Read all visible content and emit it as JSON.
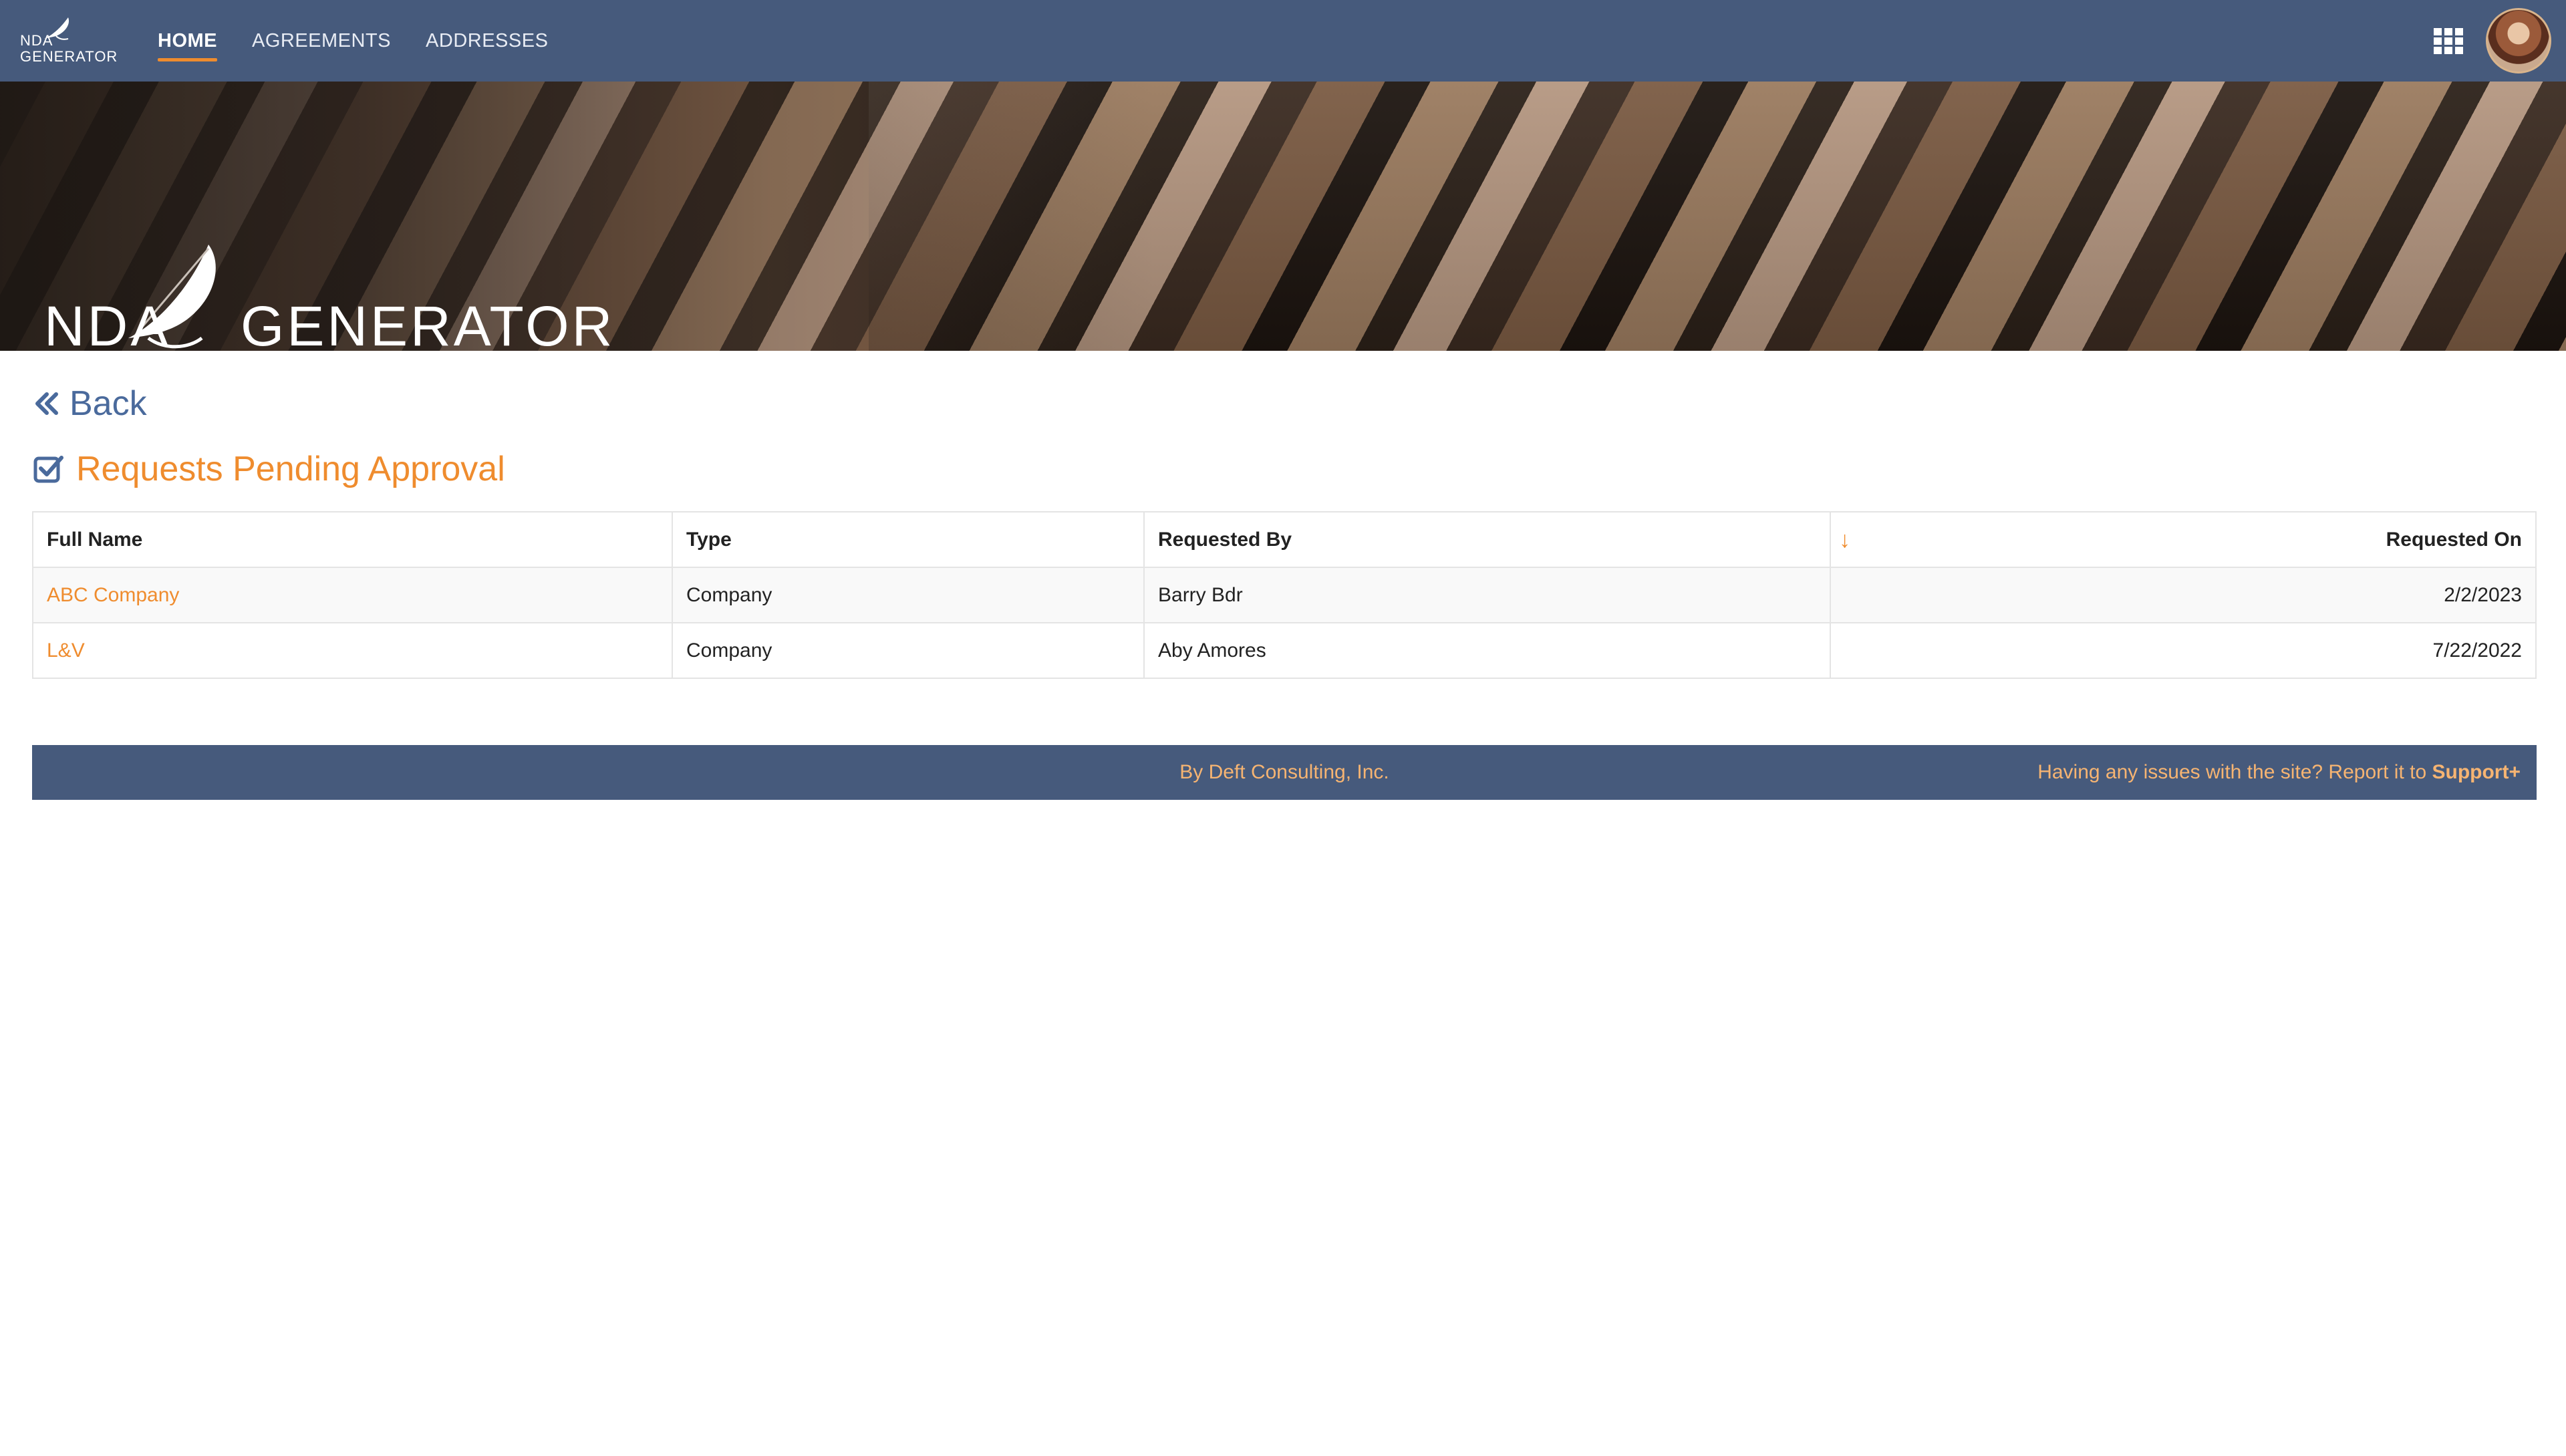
{
  "nav": {
    "logo_line1": "NDA",
    "logo_line2": "GENERATOR",
    "tabs": [
      {
        "label": "HOME",
        "active": true
      },
      {
        "label": "AGREEMENTS",
        "active": false
      },
      {
        "label": "ADDRESSES",
        "active": false
      }
    ],
    "apps_icon": "grid-icon",
    "avatar_icon": "user-avatar"
  },
  "hero": {
    "logo_left": "NDA",
    "logo_right": "GENERATOR"
  },
  "back": {
    "label": "Back",
    "icon": "double-chevron-left-icon"
  },
  "page": {
    "title": "Requests Pending Approval",
    "title_icon": "checkbox-icon"
  },
  "table": {
    "columns": [
      "Full Name",
      "Type",
      "Requested By",
      "Requested On"
    ],
    "sort_icon": "sort-down-arrow-icon",
    "rows": [
      {
        "full_name": "ABC Company",
        "type": "Company",
        "requested_by": "Barry Bdr",
        "requested_on": "2/2/2023"
      },
      {
        "full_name": "L&V",
        "type": "Company",
        "requested_by": "Aby Amores",
        "requested_on": "7/22/2022"
      }
    ]
  },
  "footer": {
    "credit": "By Deft Consulting, Inc.",
    "support_text": "Having any issues with the site? Report it to ",
    "support_link": "Support+"
  },
  "colors": {
    "nav_bg": "#465a7c",
    "accent": "#ef8c2e",
    "link_blue": "#4a6a9c"
  }
}
